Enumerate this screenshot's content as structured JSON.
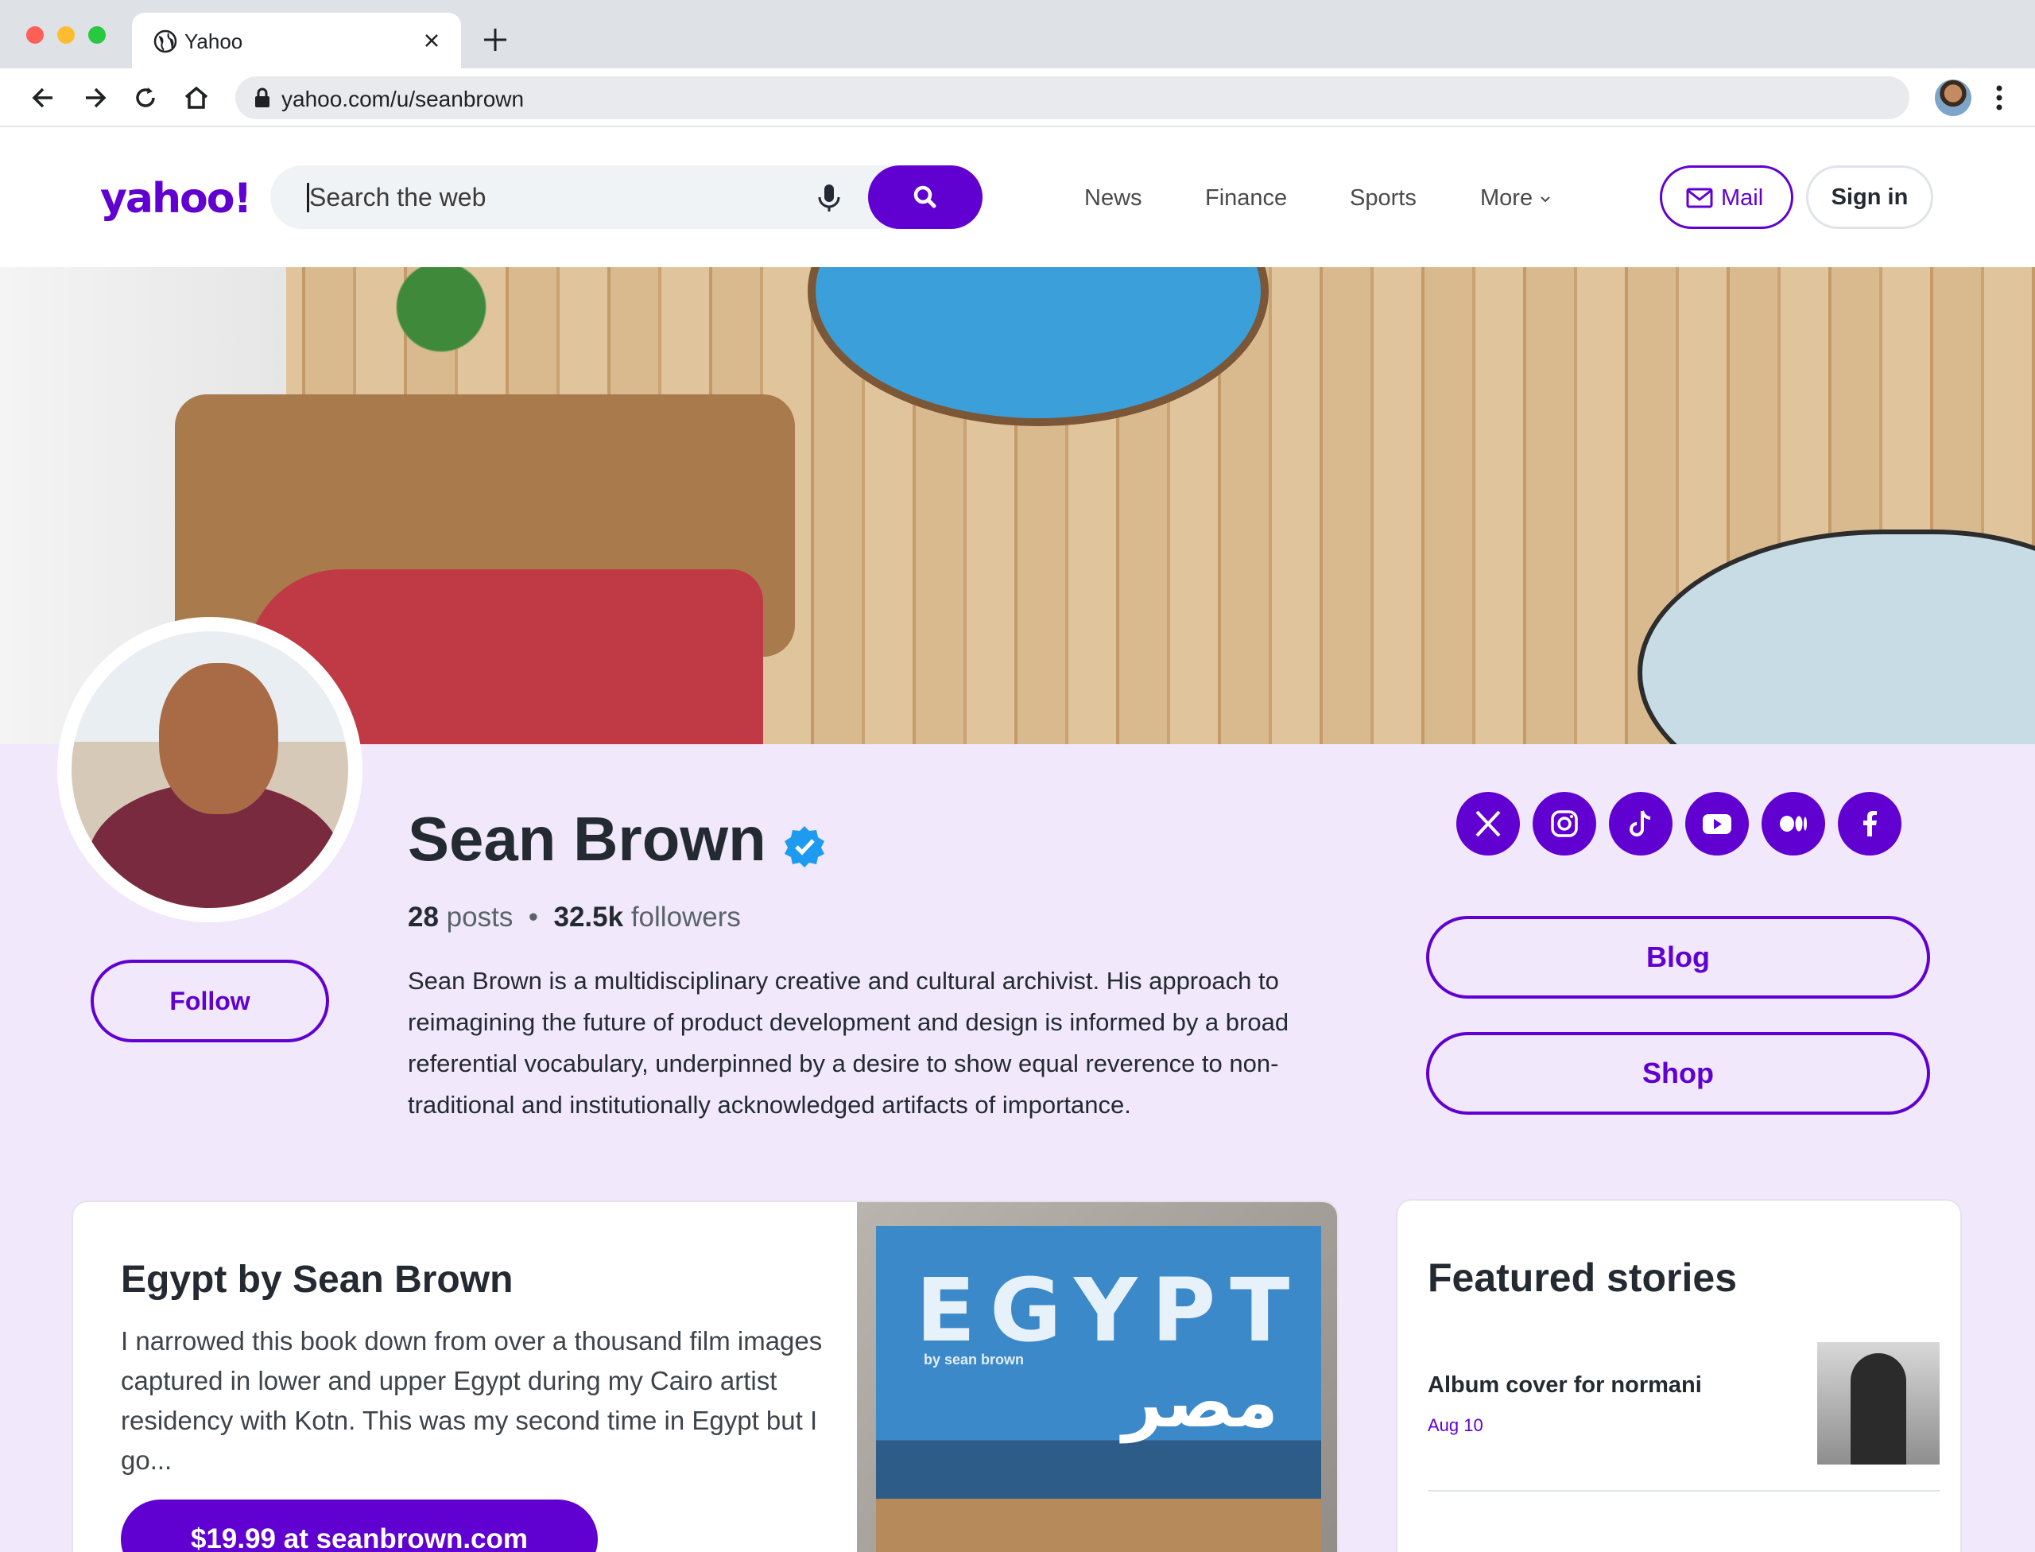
{
  "browser": {
    "tab_title": "Yahoo",
    "url": "yahoo.com/u/seanbrown"
  },
  "header": {
    "logo": "yahoo!",
    "search_placeholder": "Search the web",
    "nav": [
      "News",
      "Finance",
      "Sports",
      "More"
    ],
    "mail_label": "Mail",
    "signin_label": "Sign in"
  },
  "profile": {
    "name": "Sean Brown",
    "posts_count": "28",
    "posts_label": "posts",
    "followers_count": "32.5k",
    "followers_label": "followers",
    "bio": "Sean Brown is a multidisciplinary creative and cultural archivist. His approach to reimagining the future of product development and design is informed by a broad referential vocabulary, underpinned by a desire to show equal reverence to non-traditional and institutionally acknowledged artifacts of importance.",
    "follow_label": "Follow",
    "social_icons": [
      "x-icon",
      "instagram-icon",
      "tiktok-icon",
      "youtube-icon",
      "medium-icon",
      "facebook-icon"
    ],
    "links": [
      "Blog",
      "Shop"
    ]
  },
  "product_card": {
    "title": "Egypt by Sean Brown",
    "description": "I narrowed this book down from over a thousand film images captured in lower and upper Egypt during my Cairo artist residency with Kotn. This was my second time in Egypt but I go...",
    "button_label": "$19.99 at seanbrown.com",
    "book_cover_title": "EGYPT",
    "book_cover_subtitle": "by sean brown",
    "book_cover_arabic": "مصر"
  },
  "featured": {
    "title": "Featured stories",
    "stories": [
      {
        "title": "Album cover for normani",
        "date": "Aug 10"
      }
    ]
  },
  "colors": {
    "brand_purple": "#6001d2",
    "profile_background": "#f1e8fb",
    "verified_blue": "#1d9bf0"
  }
}
